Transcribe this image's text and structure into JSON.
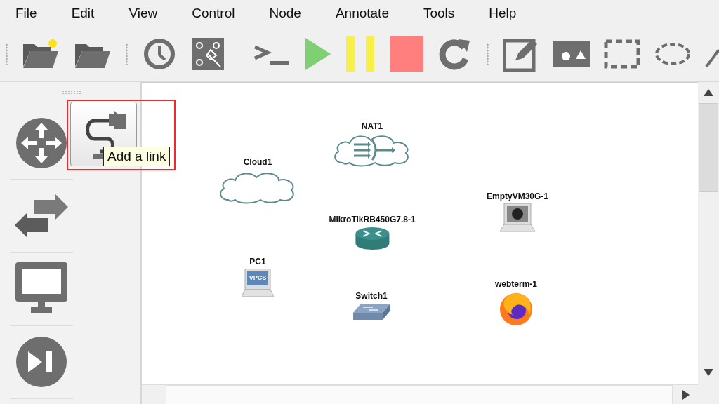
{
  "menu": [
    {
      "label": "File"
    },
    {
      "label": "Edit"
    },
    {
      "label": "View"
    },
    {
      "label": "Control"
    },
    {
      "label": "Node"
    },
    {
      "label": "Annotate"
    },
    {
      "label": "Tools"
    },
    {
      "label": "Help"
    }
  ],
  "toolbar": [
    {
      "kind": "new-project"
    },
    {
      "kind": "open-project"
    },
    {
      "kind": "sep"
    },
    {
      "kind": "snapshot"
    },
    {
      "kind": "show-names"
    },
    {
      "kind": "sep"
    },
    {
      "kind": "console"
    },
    {
      "kind": "start"
    },
    {
      "kind": "pause"
    },
    {
      "kind": "stop"
    },
    {
      "kind": "reload"
    },
    {
      "kind": "sep"
    },
    {
      "kind": "note"
    },
    {
      "kind": "image"
    },
    {
      "kind": "rectangle"
    },
    {
      "kind": "ellipse"
    },
    {
      "kind": "line"
    }
  ],
  "dock": {
    "categories": [
      {
        "kind": "routers"
      },
      {
        "kind": "switches"
      },
      {
        "kind": "end-devices"
      },
      {
        "kind": "security"
      }
    ],
    "add_link": {
      "selected": true,
      "tooltip": "Add a link",
      "highlighted": true
    }
  },
  "nodes": [
    {
      "label": "NAT1",
      "kind": "nat"
    },
    {
      "label": "Cloud1",
      "kind": "cloud"
    },
    {
      "label": "EmptyVM30G-1",
      "kind": "vm"
    },
    {
      "label": "MikroTikRB450G7.8-1",
      "kind": "router"
    },
    {
      "label": "PC1",
      "kind": "vpcs",
      "screen_text": "VPCS"
    },
    {
      "label": "webterm-1",
      "kind": "browser"
    },
    {
      "label": "Switch1",
      "kind": "switch"
    }
  ]
}
